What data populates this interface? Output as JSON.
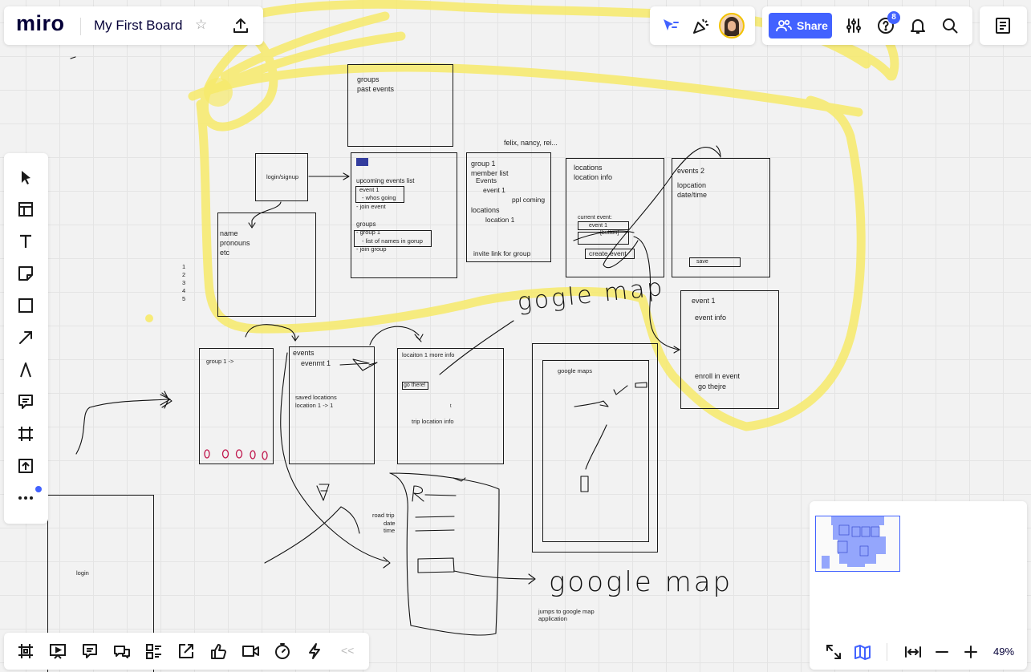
{
  "app": {
    "logo_text": "miro",
    "board_title": "My First Board",
    "share_label": "Share",
    "notification_count": "8",
    "zoom_level": "49%",
    "brand_color": "#4262ff",
    "highlight_color": "#f7e85c"
  },
  "left_toolbar": {
    "items": [
      {
        "icon": "cursor-icon"
      },
      {
        "icon": "templates-icon"
      },
      {
        "icon": "text-icon"
      },
      {
        "icon": "sticky-note-icon"
      },
      {
        "icon": "shape-icon"
      },
      {
        "icon": "arrow-line-icon"
      },
      {
        "icon": "pen-icon"
      },
      {
        "icon": "comment-icon"
      },
      {
        "icon": "frame-icon"
      },
      {
        "icon": "upload-icon"
      },
      {
        "icon": "more-icon"
      }
    ]
  },
  "bottom_toolbar": {
    "items": [
      {
        "icon": "frames-icon"
      },
      {
        "icon": "presentation-icon"
      },
      {
        "icon": "comments-icon"
      },
      {
        "icon": "chat-icon"
      },
      {
        "icon": "cards-icon"
      },
      {
        "icon": "share-screen-icon"
      },
      {
        "icon": "voting-icon"
      },
      {
        "icon": "video-icon"
      },
      {
        "icon": "timer-icon"
      },
      {
        "icon": "activity-icon"
      }
    ],
    "collapse_label": "<<"
  },
  "canvas": {
    "groups_box": {
      "line1": "groups",
      "line2": "past events"
    },
    "members_note": "felix, nancy, rei...",
    "login_signup": "login/signup",
    "profile_box": {
      "l1": "name",
      "l2": "pronouns",
      "l3": "etc"
    },
    "numbers": [
      "1",
      "2",
      "3",
      "4",
      "5"
    ],
    "home_box": {
      "upcoming": "upcoming events list",
      "event1": "event 1",
      "whos_going": "- whos going",
      "join_event": "- join event",
      "groups": "groups",
      "group1": "- group 1",
      "names_list": "- list of names in gorup",
      "join_group": "- join group"
    },
    "group_box": {
      "group1": "group 1",
      "member_list": "member list",
      "events": "Events",
      "event1": "event 1",
      "ppl_coming": "ppl coming",
      "locations": "locations",
      "location1": "location 1",
      "invite": "invite link for group"
    },
    "locations_box": {
      "l1": "locations",
      "l2": "location info",
      "current_event": "current event:",
      "event1": "event 1",
      "button": "[button]",
      "create_event": "create event"
    },
    "events2_box": {
      "title": "events 2",
      "l1": "lopcation",
      "l2": "date/time",
      "save": "save"
    },
    "event1_box": {
      "title": "event 1",
      "info": "event info",
      "enroll": "enroll in event",
      "go": "go thejre"
    },
    "group1_frame": "group 1 ->",
    "events_frame": {
      "title": "events",
      "item": "evenmt 1",
      "saved": "saved locations",
      "loc": "location 1 ->  1"
    },
    "location_frame": {
      "title": "locaiton 1 more info",
      "go_there": "go there!",
      "t": "t",
      "trip": "trip location info"
    },
    "google_maps_frame": "google maps",
    "hand_gogle_map": "gogle map",
    "road_trip": {
      "title": "road trip",
      "date": "date",
      "time": "time"
    },
    "hand_google_map": "google map",
    "jumps_note": {
      "l1": "jumps to google map",
      "l2": "application"
    },
    "login_frame": "login"
  }
}
